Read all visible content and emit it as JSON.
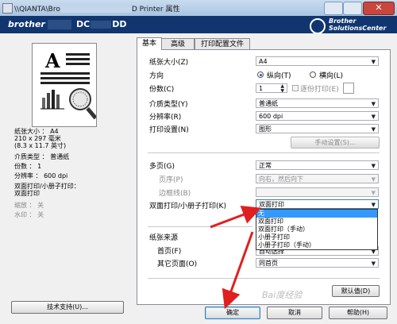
{
  "window": {
    "title": "\\\\QIANTA\\Bro",
    "title_suffix": "D Printer 属性",
    "close_glyph": "✕"
  },
  "banner": {
    "brand": "brother",
    "model": "DC",
    "model_suffix": "DD",
    "solutions": [
      "Brother",
      "SolutionsCenter"
    ]
  },
  "summary": {
    "paper_size": "纸张大小 ： A4",
    "dimensions_mm": "210 x 297 毫米",
    "dimensions_in": "(8.3 x 11.7 英寸)",
    "media_type": "介质类型 ： 普通纸",
    "copies": "份数 ： 1",
    "resolution": "分辨率 ： 600 dpi",
    "duplex": "双面打印/小册子打印：",
    "duplex_value": "双面打印",
    "scaling": "缩放 ： 关",
    "watermark": "水印 ： 关"
  },
  "support_button": "技术支持(U)...",
  "tabs": [
    "基本",
    "高级",
    "打印配置文件"
  ],
  "basic": {
    "paper_size_label": "纸张大小(Z)",
    "paper_size_value": "A4",
    "orientation_label": "方向",
    "portrait_label": "纵向(T)",
    "landscape_label": "横向(L)",
    "copies_label": "份数(C)",
    "copies_value": "1",
    "collate_label": "逐份打印(E)",
    "media_type_label": "介质类型(Y)",
    "media_type_value": "普通纸",
    "resolution_label": "分辨率(R)",
    "resolution_value": "600 dpi",
    "print_settings_label": "打印设置(N)",
    "print_settings_value": "图形",
    "manual_settings_button": "手动设置(S)...",
    "multi_page_label": "多页(G)",
    "multi_page_value": "正常",
    "page_order_label": "页序(P)",
    "page_order_value": "向右，然后向下",
    "border_line_label": "边框线(B)",
    "duplex_label": "双面打印/小册子打印(K)",
    "duplex_value": "双面打印",
    "duplex_options": [
      "无",
      "双面打印",
      "双面打印（手动）",
      "小册子打印",
      "小册子打印（手动）"
    ],
    "paper_source_label": "纸张来源",
    "first_page_label": "首页(F)",
    "first_page_value": "自动选择",
    "other_pages_label": "其它页面(O)",
    "other_pages_value": "同首页",
    "default_button": "默认值(D)"
  },
  "buttons": {
    "ok": "确定",
    "cancel": "取消",
    "help": "帮助(H)"
  },
  "watermark_text": "Bai度经验",
  "colors": {
    "banner": "#11366f",
    "selection": "#3399ff",
    "arrow": "#e02020"
  }
}
